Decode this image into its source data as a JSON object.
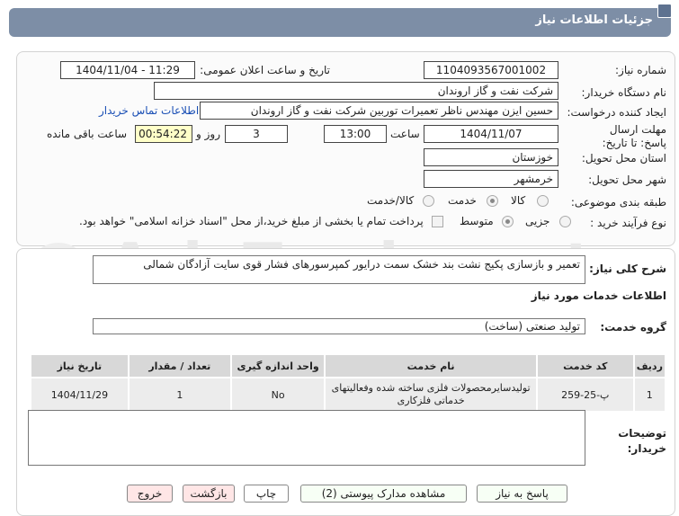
{
  "header": {
    "title": "جزئیات اطلاعات نیاز"
  },
  "watermark": {
    "text": "AriaTender.net"
  },
  "form": {
    "need_number_label": "شماره نیاز:",
    "need_number": "1104093567001002",
    "announce_label": "تاریخ و ساعت اعلان عمومی:",
    "announce_value": "1404/11/04 - 11:29",
    "buyer_org_label": "نام دستگاه خریدار:",
    "buyer_org": "شرکت نفت و گاز اروندان",
    "requester_label": "ایجاد کننده درخواست:",
    "requester": "حسین ایزن مهندس ناظر تعمیرات توربین شرکت نفت و گاز اروندان",
    "contact_link": "اطلاعات تماس خریدار",
    "deadline_label": "مهلت ارسال پاسخ: تا تاریخ:",
    "deadline_date": "1404/11/07",
    "time_label": "ساعت",
    "deadline_time": "13:00",
    "days_value": "3",
    "days_label": "روز و",
    "remaining_time": "00:54:22",
    "remaining_label": "ساعت باقی مانده",
    "province_label": "استان محل تحویل:",
    "province": "خوزستان",
    "city_label": "شهر محل تحویل:",
    "city": "خرمشهر",
    "category_label": "طبقه بندی موضوعی:",
    "category_options": [
      "کالا",
      "خدمت",
      "کالا/خدمت"
    ],
    "process_label": "نوع فرآیند خرید :",
    "process_options": [
      "جزیی",
      "متوسط"
    ],
    "payment_note": "پرداخت تمام یا بخشی از مبلغ خرید،از محل \"اسناد خزانه اسلامی\" خواهد بود."
  },
  "details": {
    "description_label": "شرح کلی نیاز:",
    "description": "تعمیر و بازسازی پکیج نشت بند خشک سمت درایور کمپرسورهای فشار قوی سایت آزادگان شمالی",
    "services_title": "اطلاعات خدمات مورد نیاز",
    "service_group_label": "گروه خدمت:",
    "service_group": "تولید صنعتی (ساخت)",
    "table": {
      "headers": [
        "ردیف",
        "کد خدمت",
        "نام خدمت",
        "واحد اندازه گیری",
        "تعداد / مقدار",
        "تاریخ نیاز"
      ],
      "rows": [
        [
          "1",
          "پ-25-259",
          "تولیدسایرمحصولات فلزی ساخته شده وفعالیتهای خدماتی فلزکاری",
          "No",
          "1",
          "1404/11/29"
        ]
      ]
    },
    "buyer_notes_label": "توضیحات خریدار:",
    "buyer_notes": ""
  },
  "buttons": {
    "reply": "پاسخ به نیاز",
    "attachments": "مشاهده مدارک پیوستی (2)",
    "print": "چاپ",
    "back": "بازگشت",
    "exit": "خروج"
  }
}
